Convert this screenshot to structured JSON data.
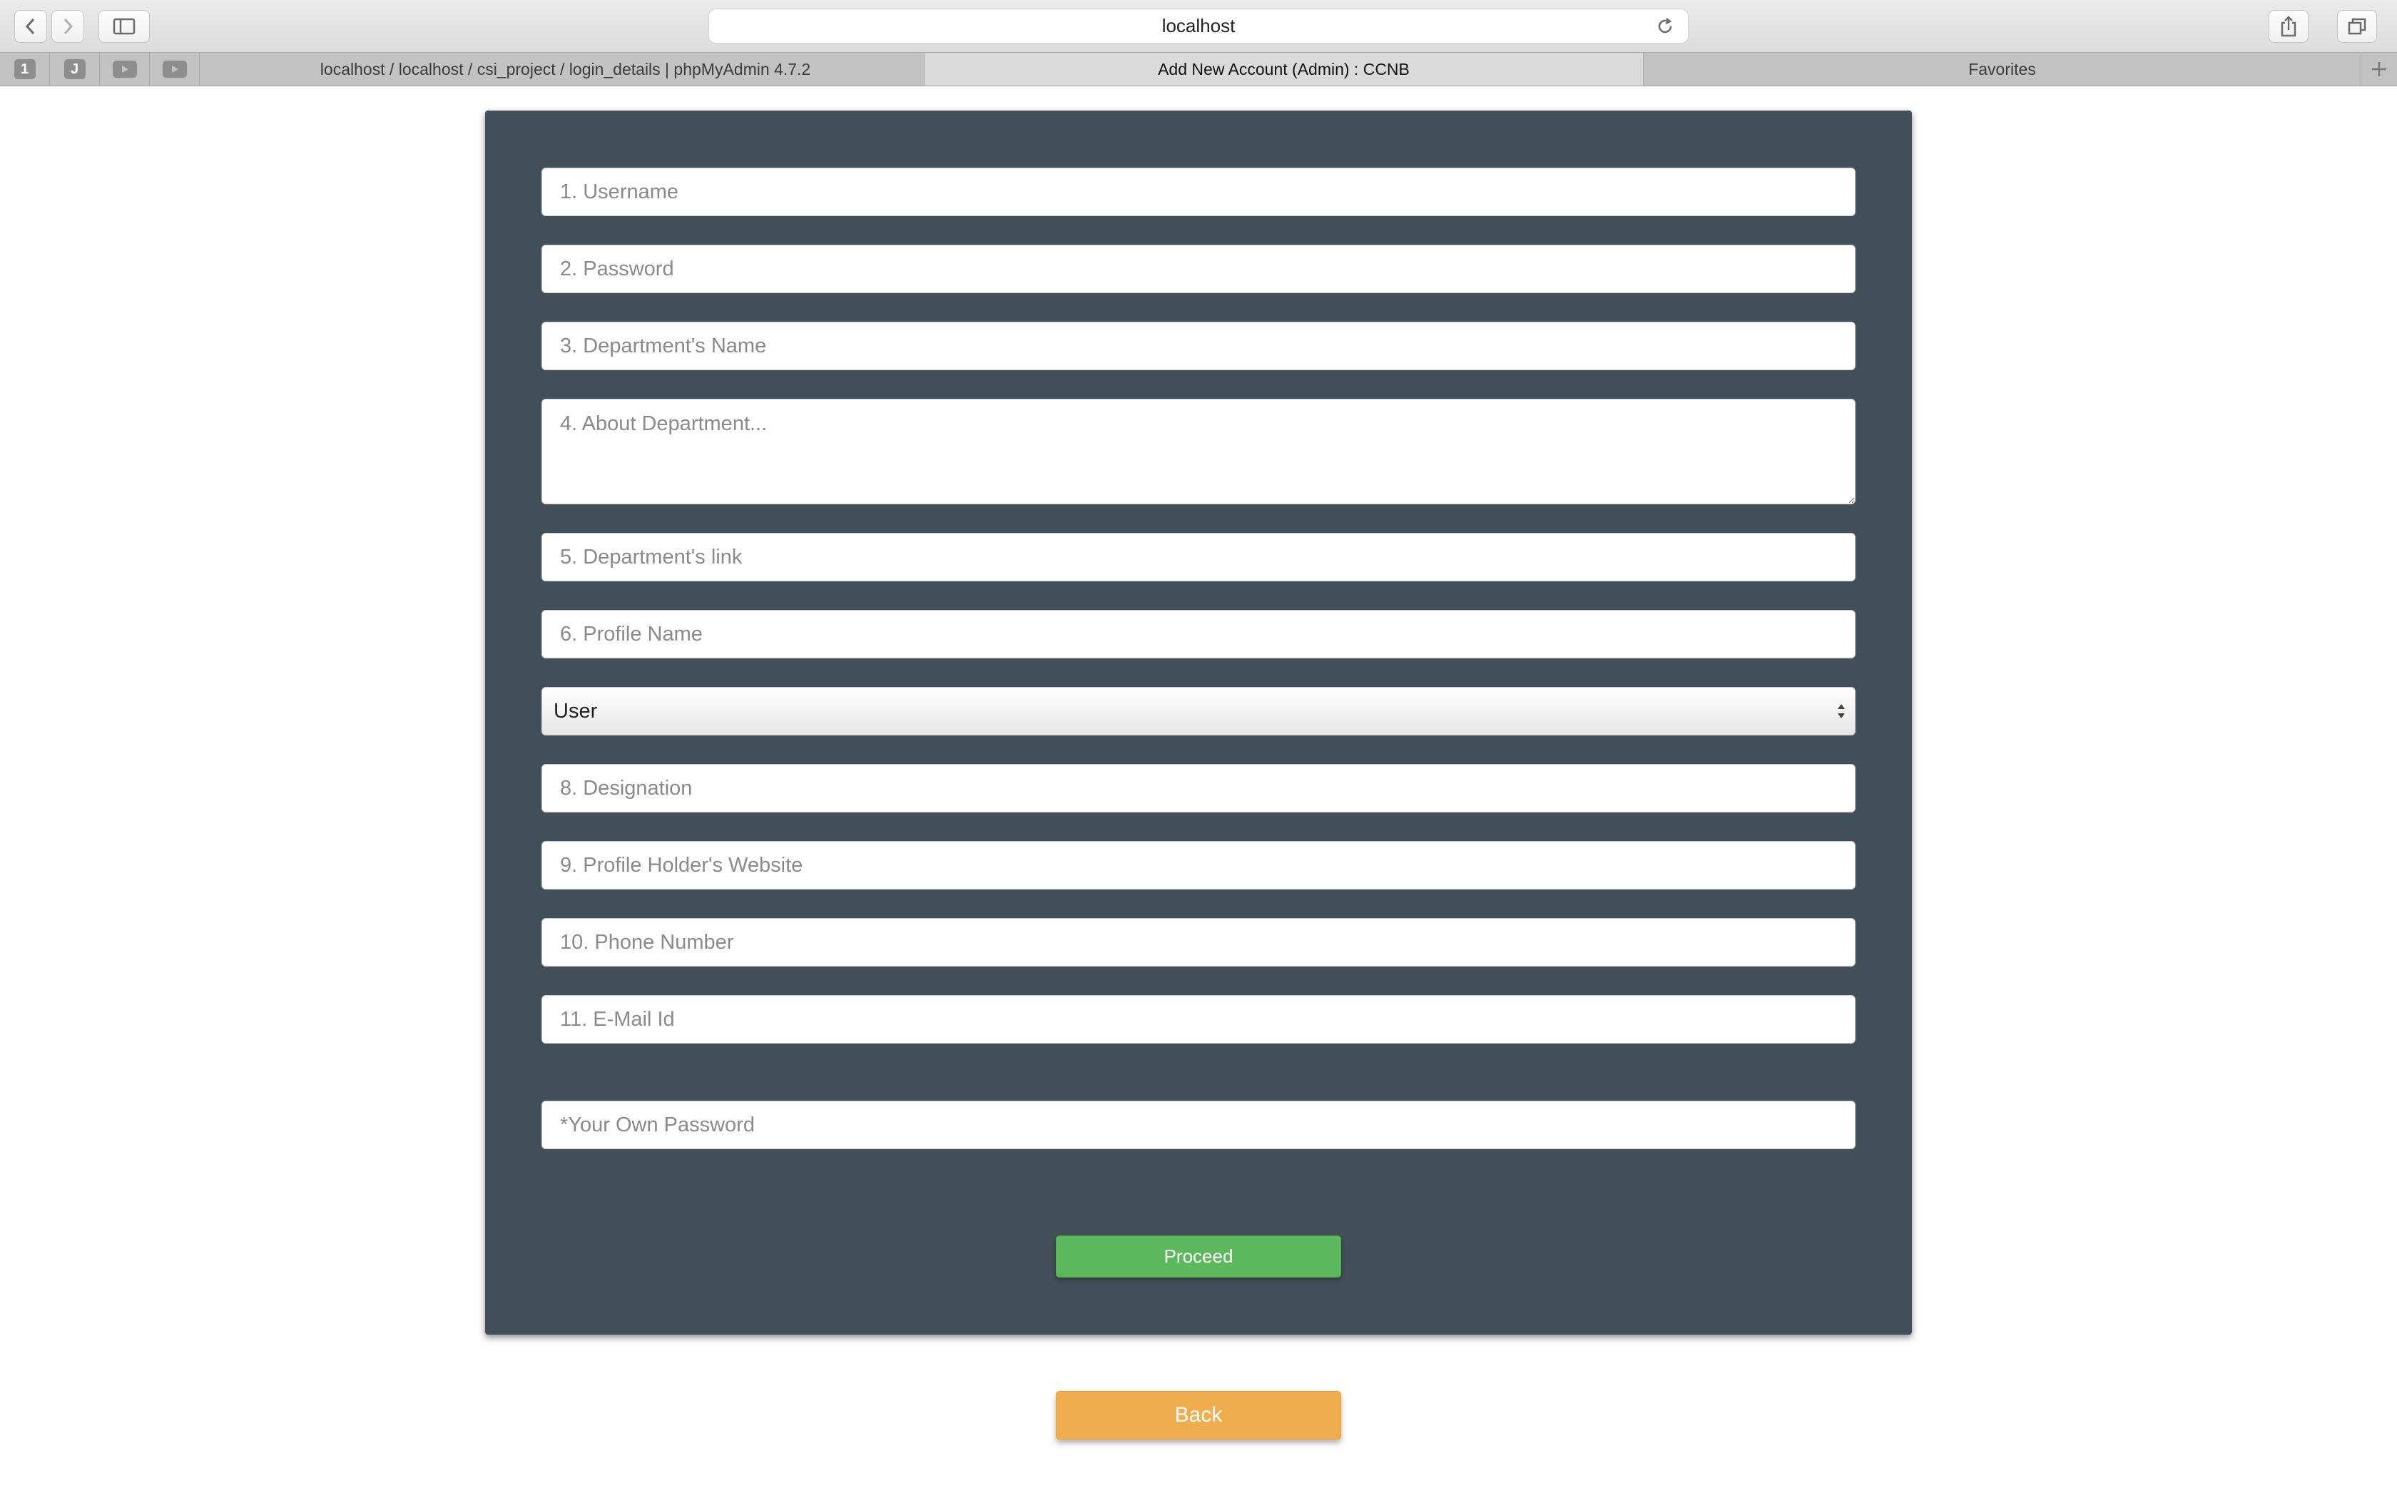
{
  "browser": {
    "address": "localhost",
    "pinned_tabs": [
      "1",
      "J",
      "",
      ""
    ],
    "tabs": [
      {
        "label": "localhost / localhost / csi_project / login_details | phpMyAdmin 4.7.2"
      },
      {
        "label": "Add New Account (Admin) : CCNB"
      },
      {
        "label": "Favorites"
      }
    ]
  },
  "form": {
    "username_placeholder": "1. Username",
    "password_placeholder": "2. Password",
    "department_name_placeholder": "3. Department's Name",
    "about_department_placeholder": "4. About Department...",
    "department_link_placeholder": "5. Department's link",
    "profile_name_placeholder": "6. Profile Name",
    "role_selected": "User",
    "designation_placeholder": "8. Designation",
    "website_placeholder": "9. Profile Holder's Website",
    "phone_placeholder": "10. Phone Number",
    "email_placeholder": "11. E-Mail Id",
    "own_password_placeholder": "*Your Own Password",
    "proceed_label": "Proceed"
  },
  "back_label": "Back"
}
